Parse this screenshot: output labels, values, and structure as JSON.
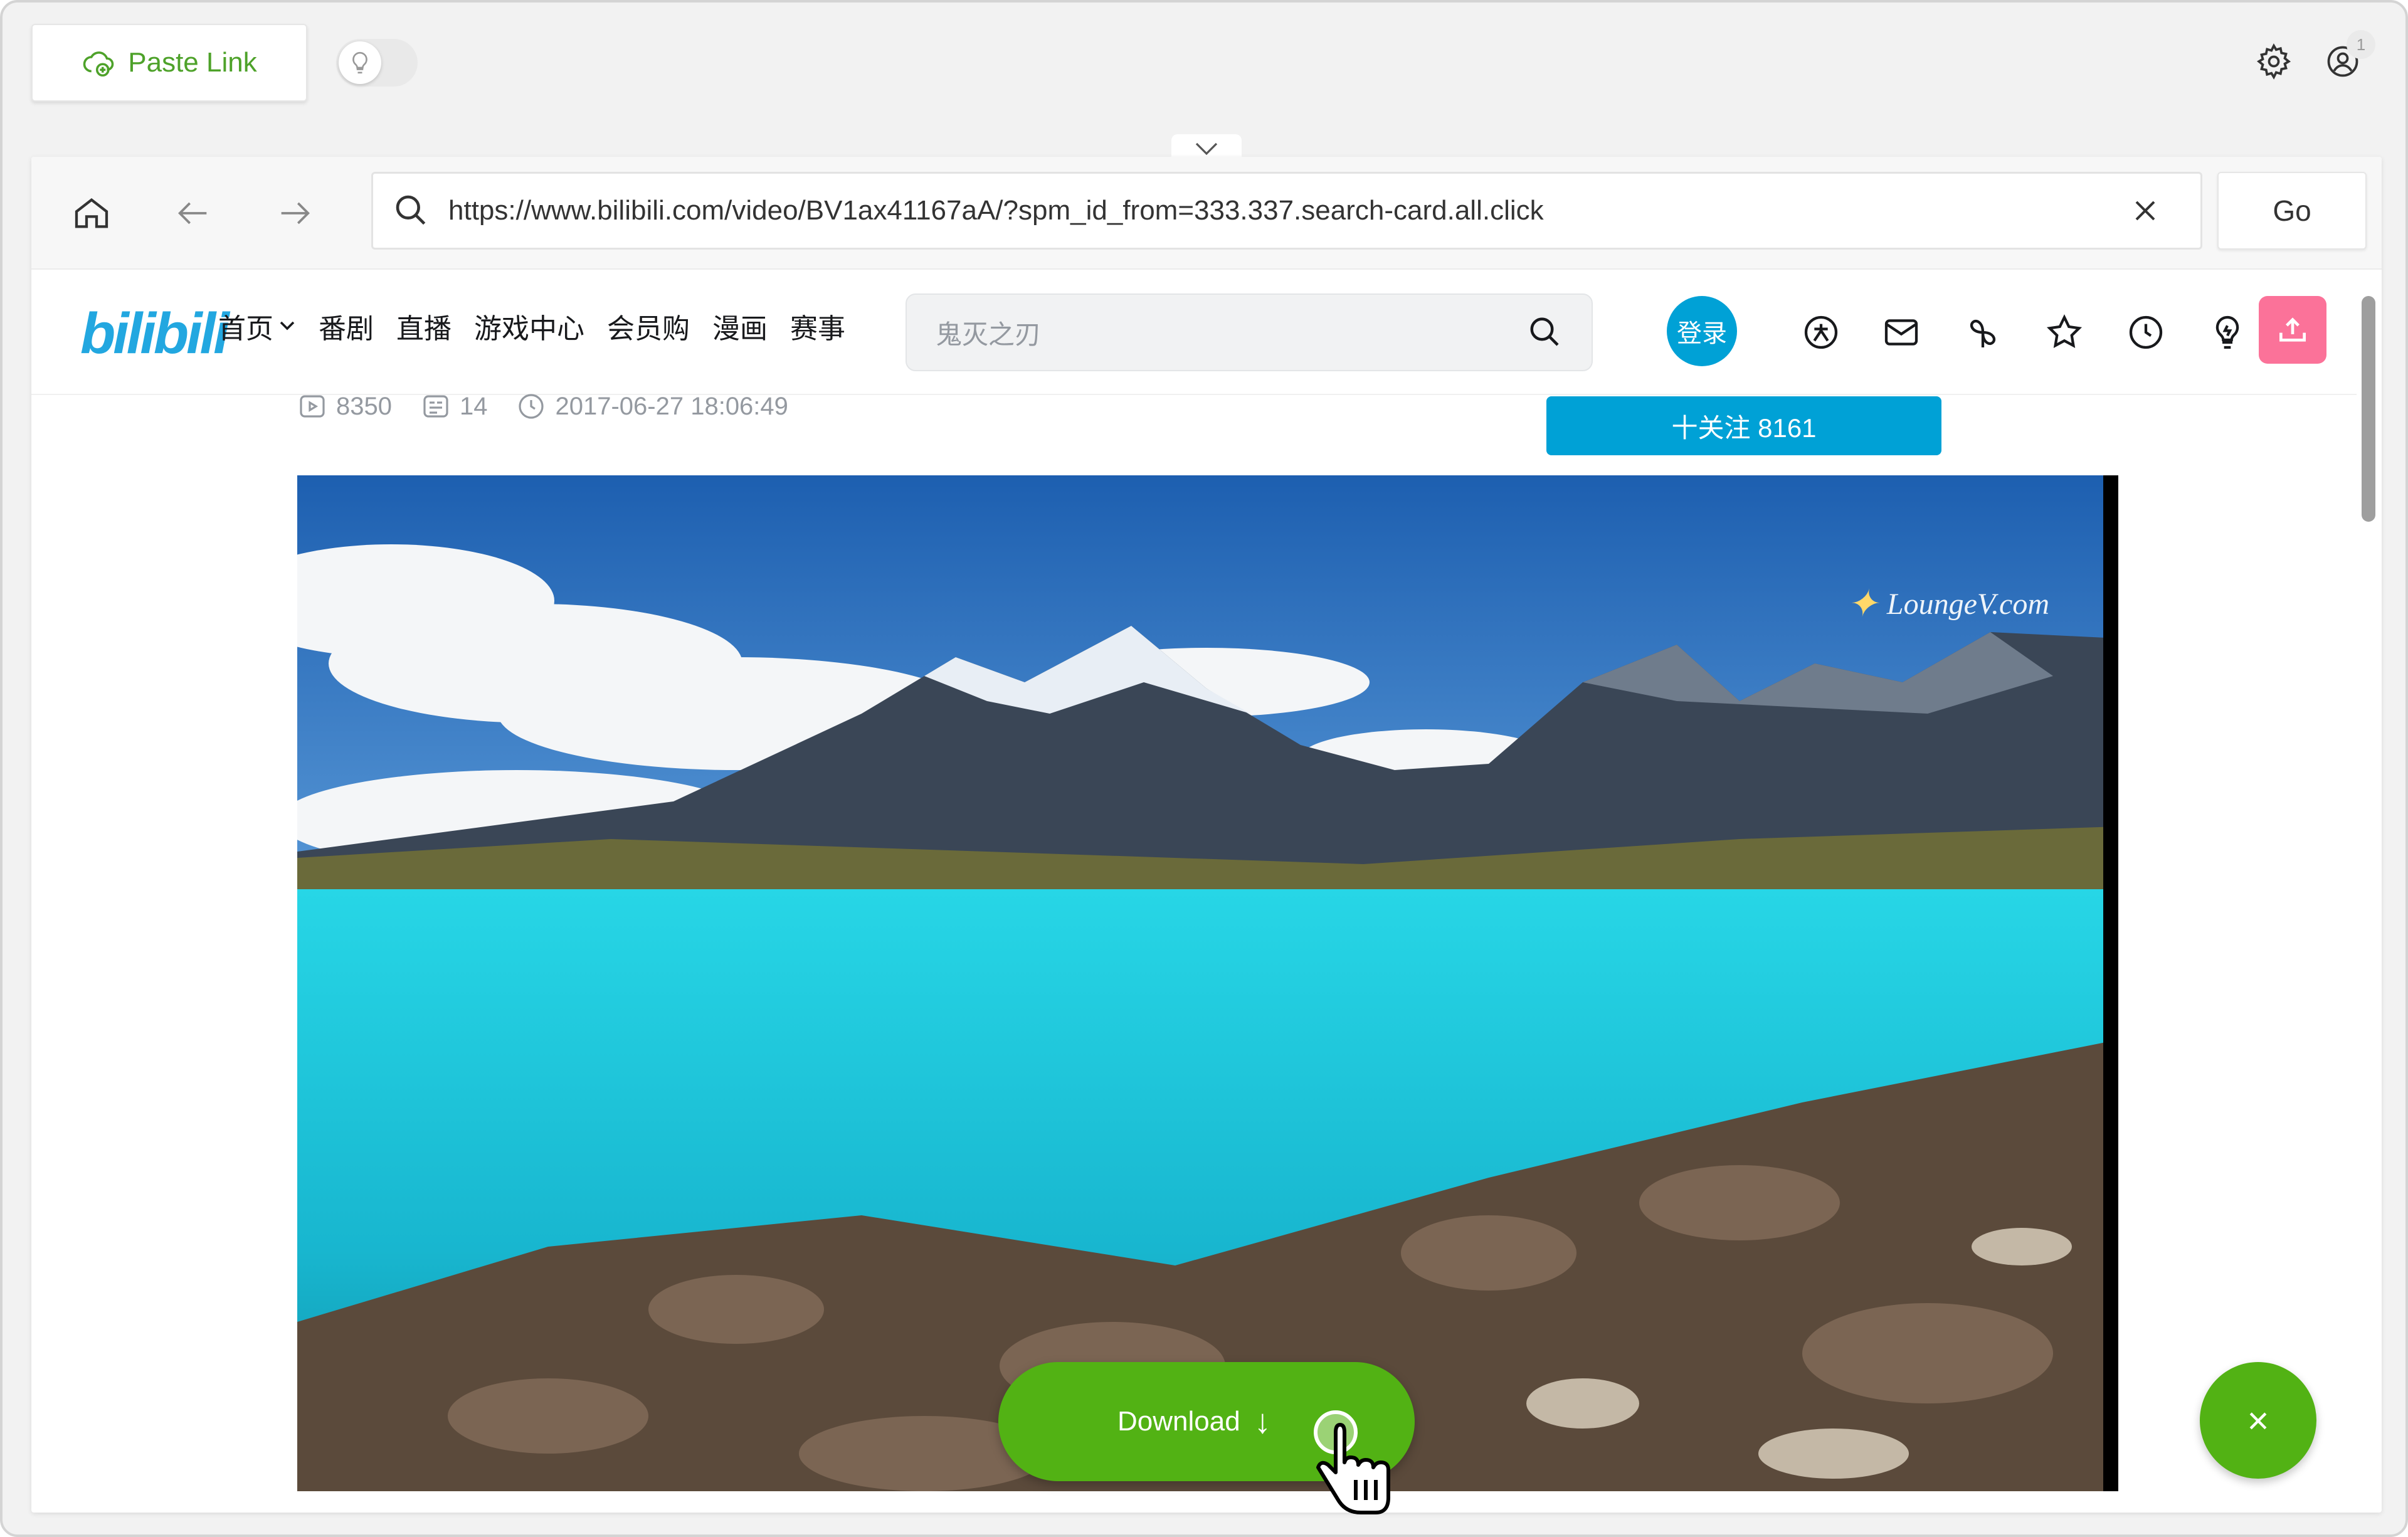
{
  "app": {
    "paste_link_label": "Paste Link",
    "notification_count": "1"
  },
  "browser": {
    "url": "https://www.bilibili.com/video/BV1ax41167aA/?spm_id_from=333.337.search-card.all.click",
    "go_label": "Go"
  },
  "site": {
    "logo": "bilibili",
    "nav": [
      "首页",
      "番剧",
      "直播",
      "游戏中心",
      "会员购",
      "漫画",
      "赛事"
    ],
    "search_placeholder": "鬼灭之刃",
    "login_label": "登录"
  },
  "video_meta": {
    "views": "8350",
    "danmaku": "14",
    "datetime": "2017-06-27 18:06:49",
    "follow_label": "十关注 8161",
    "watermark": "LoungeV.com"
  },
  "actions": {
    "download_label": "Download",
    "download_arrow": "↓",
    "close_label": "×"
  },
  "colors": {
    "accent_green": "#52b214",
    "bili_blue": "#00a1d6",
    "bili_pink": "#fb7299"
  }
}
